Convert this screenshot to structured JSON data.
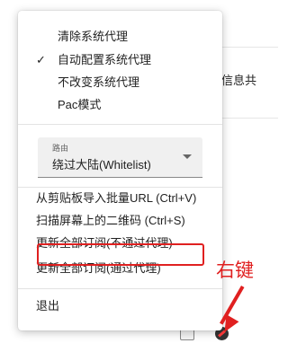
{
  "background": {
    "window_text": "信息共"
  },
  "menu": {
    "proxy_options": [
      {
        "label": "清除系统代理",
        "checked": false
      },
      {
        "label": "自动配置系统代理",
        "checked": true
      },
      {
        "label": "不改变系统代理",
        "checked": false
      },
      {
        "label": "Pac模式",
        "checked": false
      }
    ],
    "check_glyph": "✓",
    "routing": {
      "caption": "路由",
      "selected": "绕过大陆(Whitelist)"
    },
    "actions": [
      {
        "label": "从剪贴板导入批量URL (Ctrl+V)"
      },
      {
        "label": "扫描屏幕上的二维码 (Ctrl+S)"
      },
      {
        "label": "更新全部订阅(不通过代理)"
      },
      {
        "label": "更新全部订阅(通过代理)"
      }
    ],
    "exit_label": "退出"
  },
  "annotation": {
    "text": "右键",
    "color": "#e02020"
  },
  "tray": {
    "icons": [
      "network-tray-icon",
      "v2rayn-tray-icon"
    ]
  }
}
